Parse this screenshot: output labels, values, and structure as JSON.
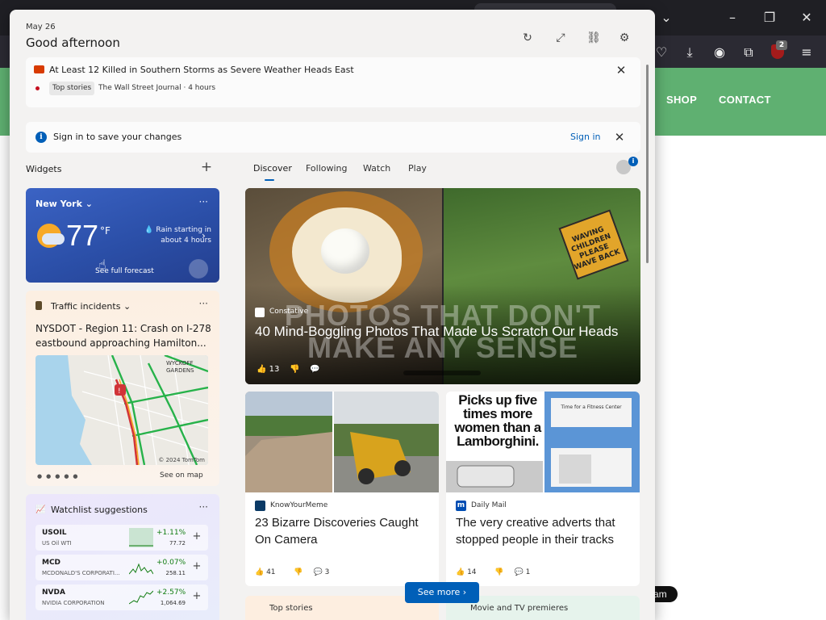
{
  "browser": {
    "nav_items": [
      "SHOP",
      "CONTACT"
    ],
    "extension_badge": "2",
    "chip_text": "am",
    "toolbar_icons": [
      "pocket-icon",
      "download-icon",
      "account-icon",
      "extensions-icon",
      "ublock-icon",
      "menu-icon"
    ],
    "window_icons": [
      "chevron-down-icon",
      "minimize-icon",
      "restore-icon",
      "close-icon"
    ],
    "accent_color": "#5fb071"
  },
  "header": {
    "date": "May 26",
    "greeting": "Good afternoon",
    "icons": [
      "refresh-icon",
      "expand-icon",
      "share-icon",
      "settings-icon"
    ]
  },
  "alert": {
    "title": "At Least 12 Killed in Southern Storms as Severe Weather Heads East",
    "tag": "Top stories",
    "source": "The Wall Street Journal · 4 hours"
  },
  "signin": {
    "message": "Sign in to save your changes",
    "link": "Sign in"
  },
  "widgets": {
    "label": "Widgets",
    "weather": {
      "city": "New York",
      "temp": "77",
      "unit": "°F",
      "rain": "Rain starting in about 4 hours",
      "forecast": "See full forecast"
    },
    "traffic": {
      "title": "Traffic incidents",
      "headline": "NYSDOT - Region 11: Crash on I-278 eastbound approaching Hamilton...",
      "map_label": "WYCKOFF GARDENS",
      "map_credit": "© 2024 TomTom",
      "see_map": "See on map"
    },
    "watchlist": {
      "title": "Watchlist suggestions",
      "stocks": [
        {
          "symbol": "USOIL",
          "name": "US Oil WTI",
          "change": "+1.11%",
          "price": "77.72"
        },
        {
          "symbol": "MCD",
          "name": "MCDONALD'S CORPORATI...",
          "change": "+0.07%",
          "price": "258.11"
        },
        {
          "symbol": "NVDA",
          "name": "NVIDIA CORPORATION",
          "change": "+2.57%",
          "price": "1,064.69"
        }
      ],
      "positive_color": "#107c10"
    }
  },
  "feed": {
    "tabs": [
      "Discover",
      "Following",
      "Watch",
      "Play"
    ],
    "active_tab": "Discover",
    "profile_badge": "i",
    "hero": {
      "overlay_text": "PHOTOS THAT DON'T MAKE ANY SENSE",
      "source": "Constative",
      "title": "40 Mind-Boggling Photos That Made Us Scratch Our Heads",
      "likes": "13",
      "sign_text": "WAVING CHILDREN PLEASE WAVE BACK"
    },
    "cards": [
      {
        "source": "KnowYourMeme",
        "title": "23 Bizarre Discoveries Caught On Camera",
        "likes": "41",
        "comments": "3",
        "logo_letter": "",
        "logo_color": "#0b3a66"
      },
      {
        "source": "Daily Mail",
        "title": "The very creative adverts that stopped people in their tracks",
        "likes": "14",
        "comments": "1",
        "logo_letter": "m",
        "logo_color": "#004db3",
        "image_text": "Picks up five times more women than a Lamborghini.",
        "billboard_text": "Time for a Fitness Center"
      }
    ],
    "see_more": "See more",
    "peek": [
      "Top stories",
      "Movie and TV premieres"
    ]
  }
}
